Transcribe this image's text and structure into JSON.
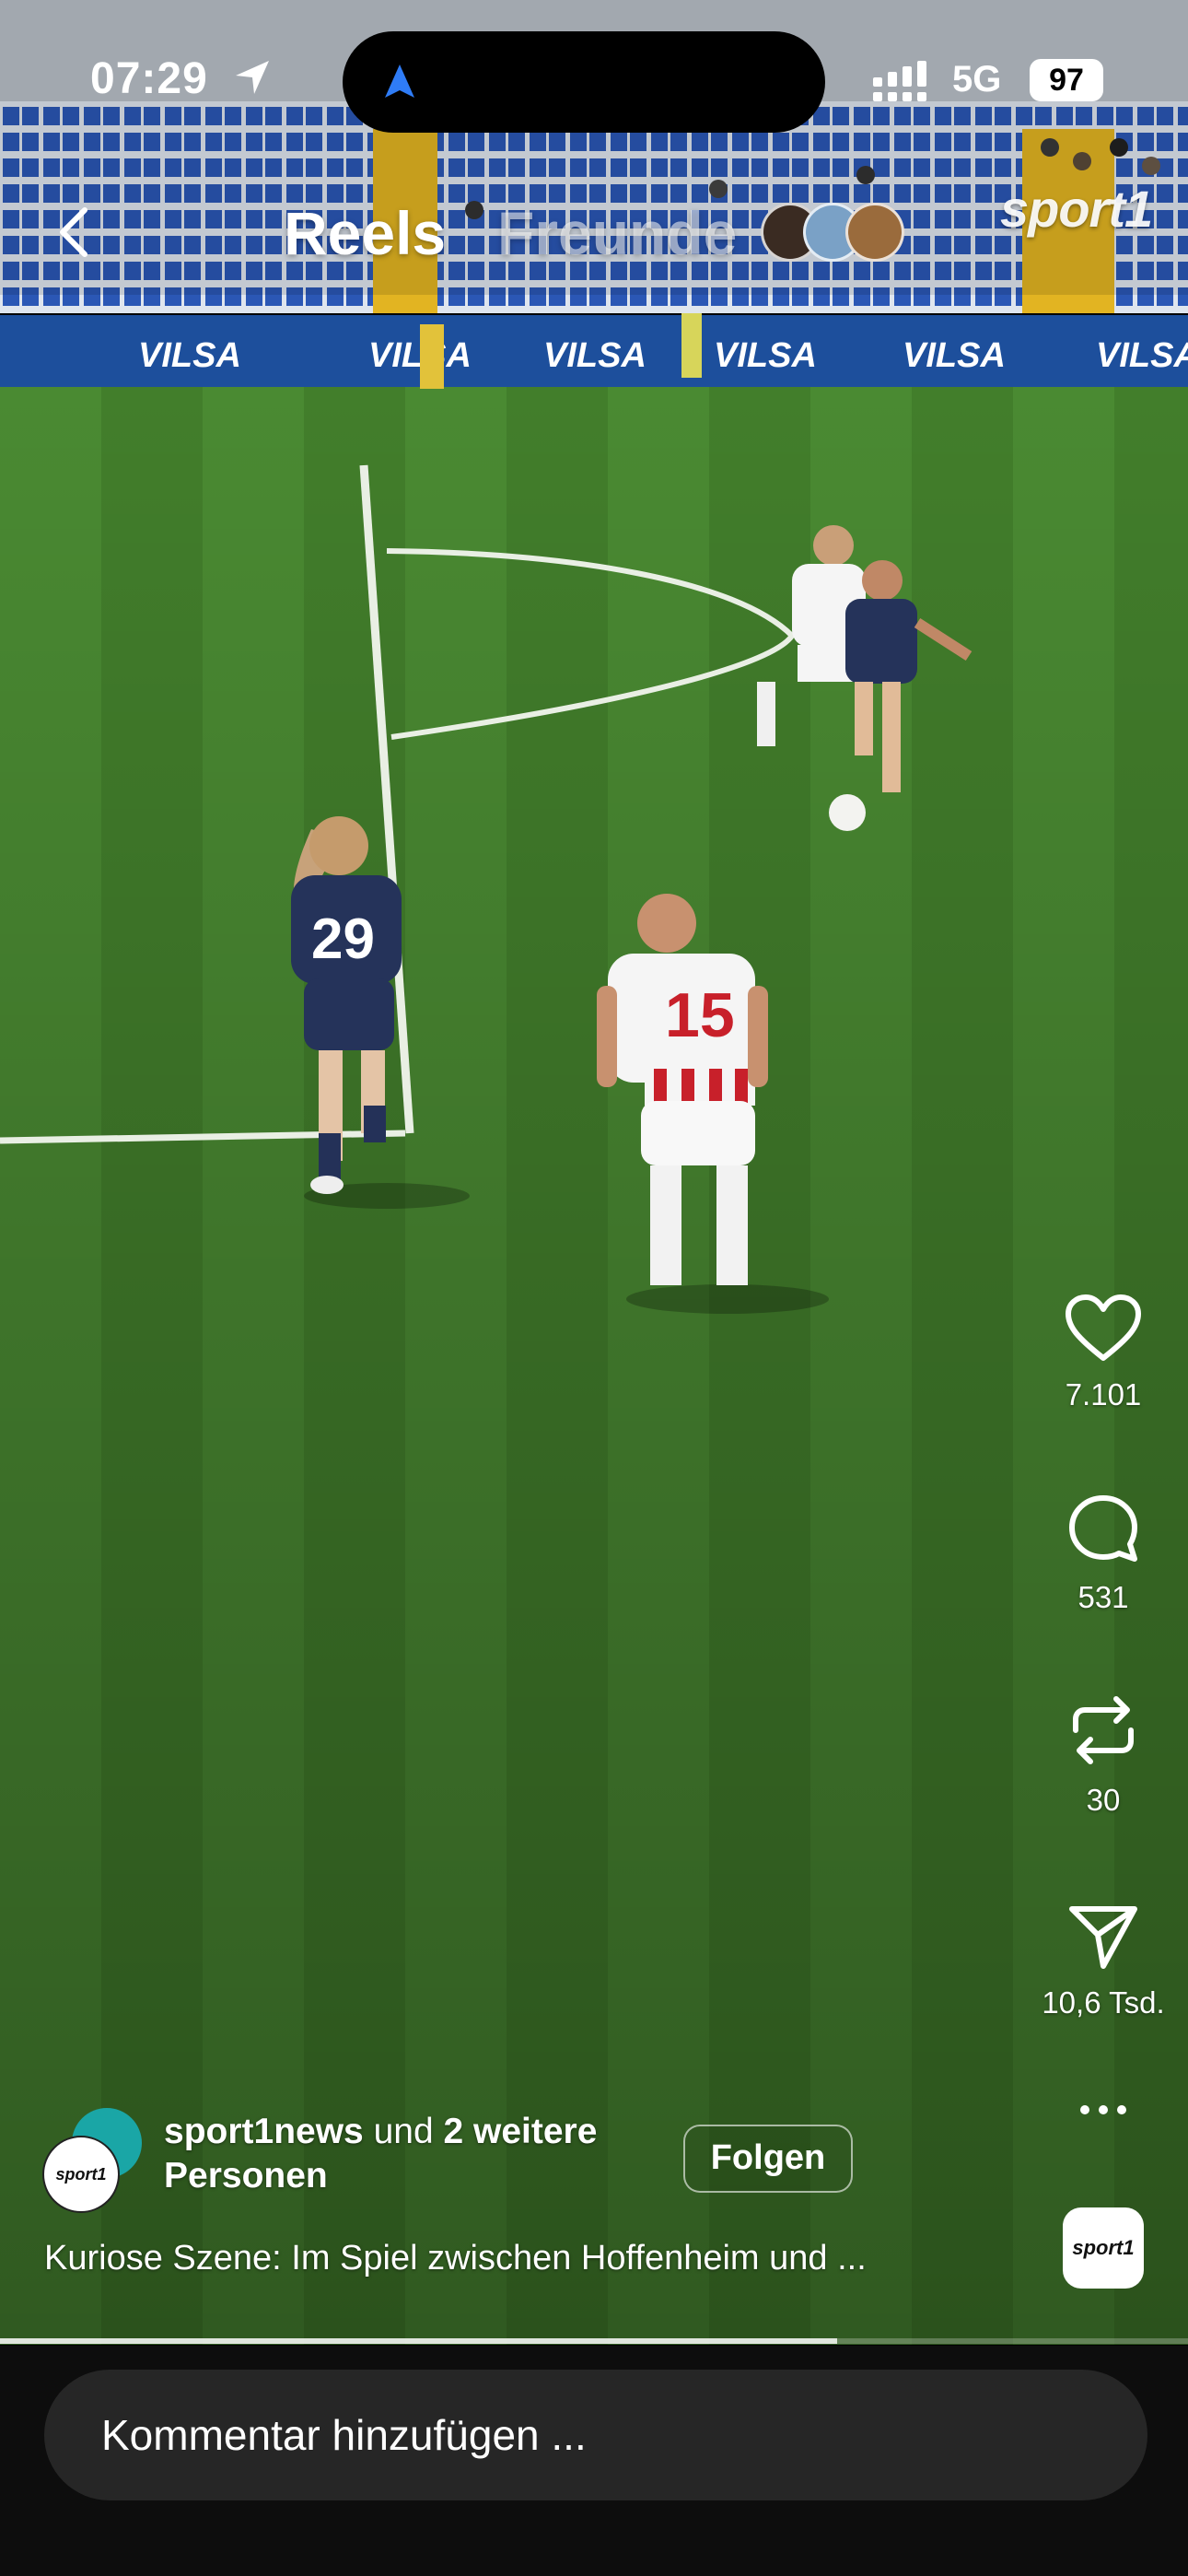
{
  "status_bar": {
    "time": "07:29",
    "network": "5G",
    "battery": "97"
  },
  "nav": {
    "tab_reels": "Reels",
    "tab_friends": "Freunde"
  },
  "brand_watermark": "sport1",
  "actions": {
    "likes": "7.101",
    "comments": "531",
    "reposts": "30",
    "shares": "10,6 Tsd."
  },
  "author": {
    "name": "sport1news",
    "connector": " und ",
    "others": "2 weitere Personen",
    "avatar_label": "sport1"
  },
  "follow_label": "Folgen",
  "caption": "Kuriose Szene: Im Spiel zwischen Hoffenheim und ...",
  "audio_label": "sport1",
  "comment_placeholder": "Kommentar hinzufügen ...",
  "video_progress": 0.705,
  "scene": {
    "ad_banner_text": "VILSA",
    "player_numbers": [
      "29",
      "15"
    ]
  },
  "colors": {
    "pitch": "#3f7d2c",
    "stand_blue": "#1f4fa8",
    "ad_board": "#1d4f9c",
    "follow_border": "#ffffff",
    "comment_bg": "#262626"
  },
  "icons": [
    "back-chevron-icon",
    "heart-icon",
    "comment-bubble-icon",
    "repost-icon",
    "paper-plane-icon",
    "more-dots-icon",
    "location-arrow-icon",
    "signal-icon"
  ]
}
